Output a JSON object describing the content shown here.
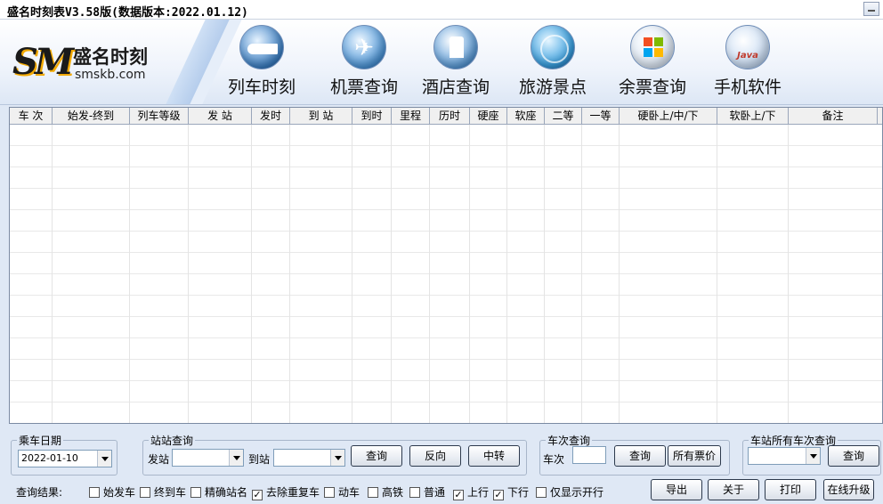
{
  "window": {
    "title": "盛名时刻表V3.58版(数据版本:2022.01.12)"
  },
  "logo": {
    "mark": "SM",
    "name": "盛名时刻",
    "site": "smskb.com"
  },
  "nav": [
    {
      "label": "列车时刻",
      "icon": "train-icon"
    },
    {
      "label": "机票查询",
      "icon": "airplane-icon"
    },
    {
      "label": "酒店查询",
      "icon": "hotel-icon"
    },
    {
      "label": "旅游景点",
      "icon": "globe-icon"
    },
    {
      "label": "余票查询",
      "icon": "windows-icon"
    },
    {
      "label": "手机软件",
      "icon": "java-icon"
    }
  ],
  "table": {
    "columns": [
      "车 次",
      "始发-终到",
      "列车等级",
      "发  站",
      "发时",
      "到  站",
      "到时",
      "里程",
      "历时",
      "硬座",
      "软座",
      "二等",
      "一等",
      "硬卧上/中/下",
      "软卧上/下",
      "备注"
    ],
    "rows": []
  },
  "bottom": {
    "date_group": {
      "legend": "乘车日期",
      "value": "2022-01-10"
    },
    "station_group": {
      "legend": "站站查询",
      "from_label": "发站",
      "to_label": "到站",
      "from_value": "",
      "to_value": "",
      "query_button": "查询",
      "reverse_button": "反向",
      "transfer_button": "中转"
    },
    "train_group": {
      "legend": "车次查询",
      "train_label": "车次",
      "train_value": "",
      "query_button": "查询",
      "all_price_button": "所有票价"
    },
    "station_all_group": {
      "legend": "车站所有车次查询",
      "station_value": "",
      "query_button": "查询"
    },
    "result_label": "查询结果:",
    "filters": [
      {
        "label": "始发车",
        "checked": false
      },
      {
        "label": "终到车",
        "checked": false
      },
      {
        "label": "精确站名",
        "checked": false
      },
      {
        "label": "去除重复车",
        "checked": true
      },
      {
        "label": "动车",
        "checked": false
      },
      {
        "label": "高铁",
        "checked": false
      },
      {
        "label": "普通",
        "checked": false
      },
      {
        "label": "上行",
        "checked": true
      },
      {
        "label": "下行",
        "checked": true
      },
      {
        "label": "仅显示开行",
        "checked": false
      }
    ],
    "actions": {
      "export": "导出",
      "about": "关于",
      "print": "打印",
      "upgrade": "在线升级"
    }
  }
}
